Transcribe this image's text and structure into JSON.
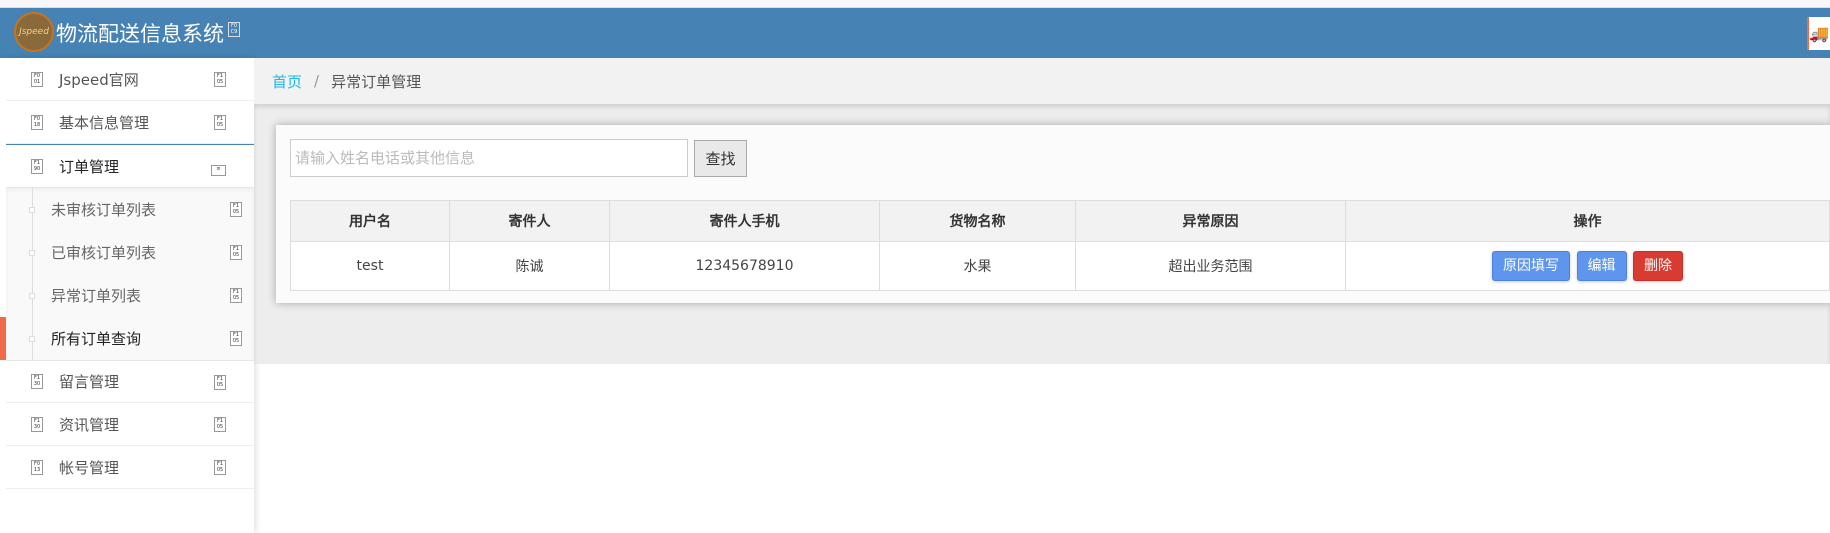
{
  "app": {
    "title": "物流配送信息系统",
    "logo_text": "Jspeed"
  },
  "sidebar": {
    "items": [
      {
        "label": "Jspeed官网"
      },
      {
        "label": "基本信息管理"
      },
      {
        "label": "订单管理"
      }
    ],
    "sub_items": [
      {
        "label": "未审核订单列表"
      },
      {
        "label": "已审核订单列表"
      },
      {
        "label": "异常订单列表"
      },
      {
        "label": "所有订单查询"
      }
    ],
    "items_after": [
      {
        "label": "留言管理"
      },
      {
        "label": "资讯管理"
      },
      {
        "label": "帐号管理"
      }
    ]
  },
  "breadcrumb": {
    "home": "首页",
    "separator": "/",
    "current": "异常订单管理"
  },
  "search": {
    "placeholder": "请输入姓名电话或其他信息",
    "value": "",
    "button": "查找"
  },
  "table": {
    "headers": [
      "用户名",
      "寄件人",
      "寄件人手机",
      "货物名称",
      "异常原因",
      "操作"
    ],
    "rows": [
      [
        "test",
        "陈诚",
        "12345678910",
        "水果",
        "超出业务范围"
      ]
    ],
    "actions": {
      "reason": "原因填写",
      "edit": "编辑",
      "delete": "删除"
    }
  },
  "colors": {
    "header": "#4682b4",
    "accent": "#f06a4a",
    "link": "#1fb5e6",
    "primary": "#5f95ec",
    "danger": "#d83b30"
  }
}
